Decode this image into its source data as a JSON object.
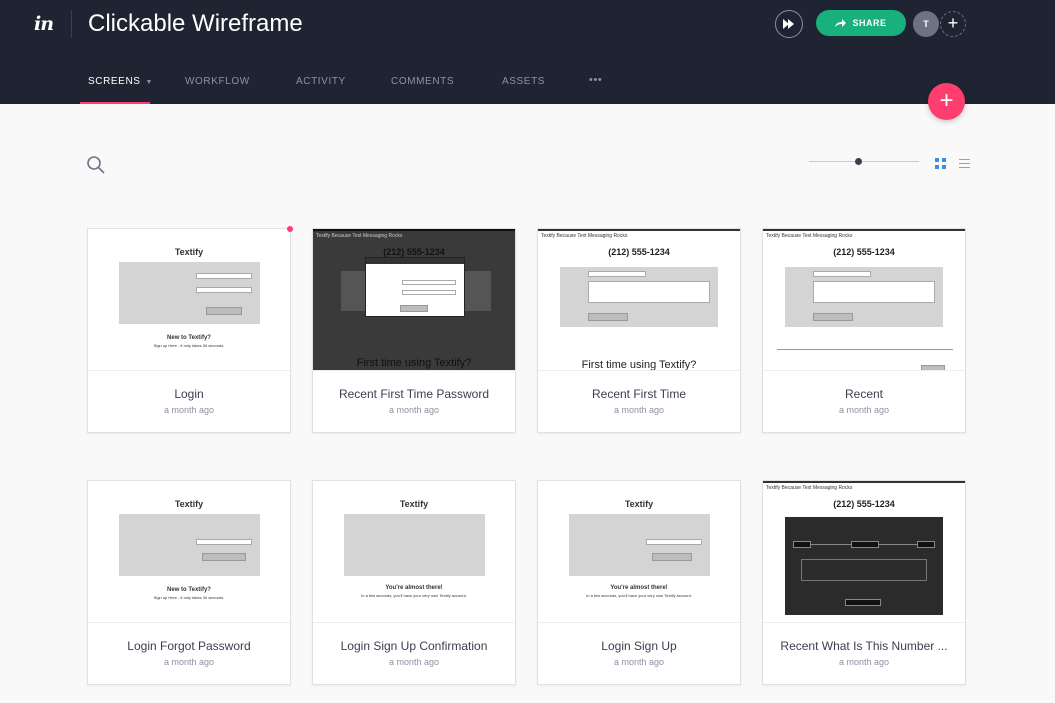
{
  "app": {
    "logo": "in",
    "title": "Clickable Wireframe"
  },
  "header": {
    "share_label": "SHARE",
    "avatar_initial": "T",
    "add_label": "+"
  },
  "nav": {
    "tabs": [
      {
        "label": "SCREENS",
        "active": true
      },
      {
        "label": "WORKFLOW",
        "active": false
      },
      {
        "label": "ACTIVITY",
        "active": false
      },
      {
        "label": "COMMENTS",
        "active": false
      },
      {
        "label": "ASSETS",
        "active": false
      },
      {
        "label": "•••",
        "active": false
      }
    ]
  },
  "fab_label": "+",
  "zoom_level": 0.45,
  "colors": {
    "header_bg": "#1f2433",
    "accent_pink": "#ff3d6e",
    "share_green": "#18b07c"
  },
  "screens": [
    {
      "name": "Login",
      "time": "a month ago",
      "unread": true
    },
    {
      "name": "Recent First Time Password",
      "time": "a month ago"
    },
    {
      "name": "Recent First Time",
      "time": "a month ago"
    },
    {
      "name": "Recent",
      "time": "a month ago"
    },
    {
      "name": "Login Forgot Password",
      "time": "a month ago"
    },
    {
      "name": "Login Sign Up Confirmation",
      "time": "a month ago"
    },
    {
      "name": "Login Sign Up",
      "time": "a month ago"
    },
    {
      "name": "Recent What Is This Number ...",
      "time": "a month ago"
    }
  ],
  "mock": {
    "brand": "Textify",
    "brand_tag": "Textify Because Text Messaging Rocks",
    "phone": "(212) 555-1234",
    "new_to": "New to Textify?",
    "signup_line": "Sign up Here - it only takes 30 seconds.",
    "first_time": "First time using Textify?",
    "almost": "You're almost there!",
    "almost_sub": "In a few seconds, you'll have your very own Textify account."
  }
}
